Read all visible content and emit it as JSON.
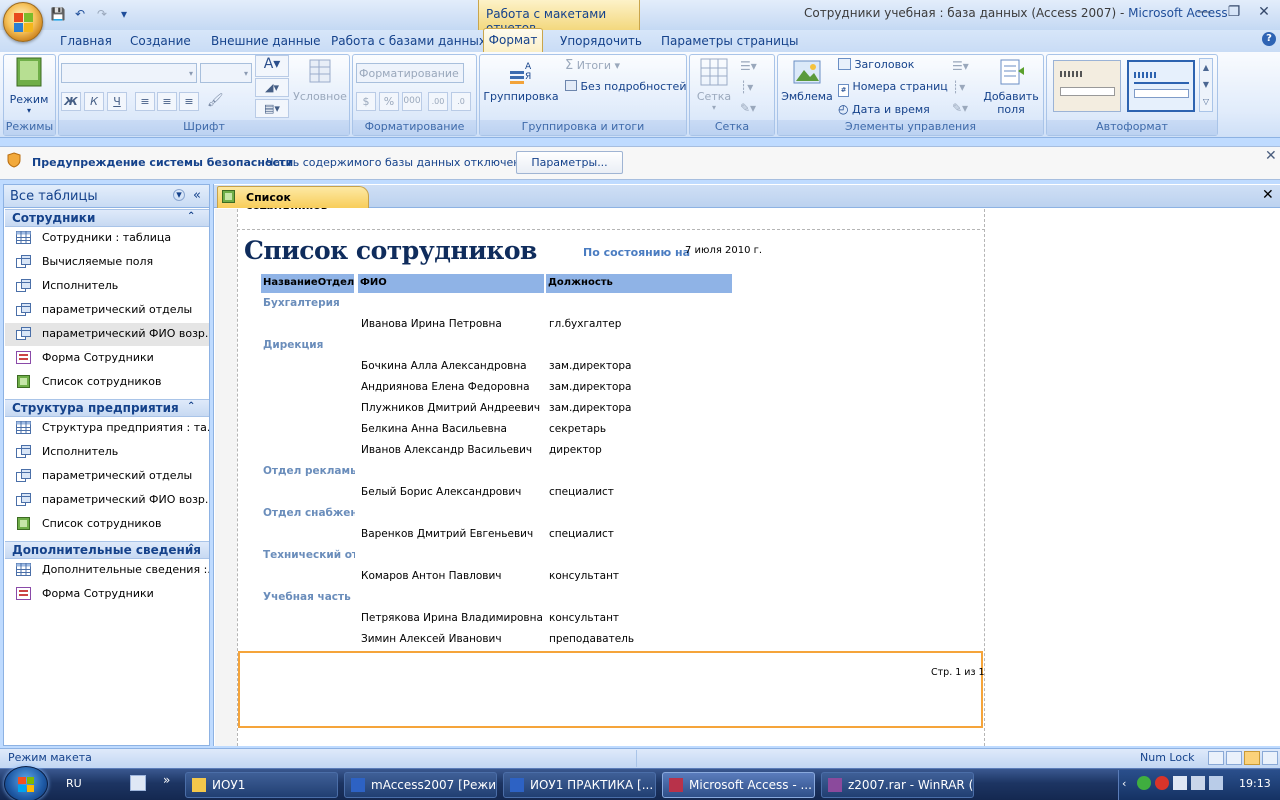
{
  "window": {
    "title": "Сотрудники учебная : база данных (Access 2007)",
    "title_sep": " - ",
    "app": "Microsoft Access",
    "context_tab_title": "Работа с макетами отчетов"
  },
  "tabs": [
    "Главная",
    "Создание",
    "Внешние данные",
    "Работа с базами данных",
    "Формат",
    "Упорядочить",
    "Параметры страницы"
  ],
  "ribbon": {
    "groups": {
      "views": "Режимы",
      "font": "Шрифт",
      "formatting": "Форматирование",
      "grouping": "Группировка и итоги",
      "gridlines": "Сетка",
      "controls": "Элементы управления",
      "autoformat": "Автоформат"
    },
    "buttons": {
      "view": "Режим",
      "conditional": "Условное",
      "format_combo": "Форматирование",
      "group": "Группировка",
      "totals": "Итоги",
      "hide_details": "Без подробностей",
      "gridlines": "Сетка",
      "logo": "Эмблема",
      "title": "Заголовок",
      "page_numbers": "Номера страниц",
      "date_time": "Дата и время",
      "add_fields_1": "Добавить",
      "add_fields_2": "поля"
    }
  },
  "security": {
    "title": "Предупреждение системы безопасности",
    "message": "Часть содержимого базы данных отключено",
    "button": "Параметры..."
  },
  "nav": {
    "header": "Все таблицы",
    "groups": [
      {
        "name": "Сотрудники",
        "items": [
          {
            "label": "Сотрудники : таблица",
            "icon": "table-icon"
          },
          {
            "label": "Вычисляемые поля",
            "icon": "query-icon"
          },
          {
            "label": "Исполнитель",
            "icon": "query-icon"
          },
          {
            "label": "параметрический отделы",
            "icon": "query-icon"
          },
          {
            "label": "параметрический ФИО возр...",
            "icon": "query-icon"
          },
          {
            "label": "Форма Сотрудники",
            "icon": "form-icon"
          },
          {
            "label": "Список сотрудников",
            "icon": "report-icon"
          }
        ]
      },
      {
        "name": "Структура предприятия",
        "items": [
          {
            "label": "Структура предприятия : та...",
            "icon": "table-icon"
          },
          {
            "label": "Исполнитель",
            "icon": "query-icon"
          },
          {
            "label": "параметрический отделы",
            "icon": "query-icon"
          },
          {
            "label": "параметрический ФИО возр...",
            "icon": "query-icon"
          },
          {
            "label": "Список сотрудников",
            "icon": "report-icon"
          }
        ]
      },
      {
        "name": "Дополнительные сведения",
        "items": [
          {
            "label": "Дополнительные сведения :...",
            "icon": "table-icon"
          },
          {
            "label": "Форма Сотрудники",
            "icon": "form-icon"
          }
        ]
      }
    ]
  },
  "document": {
    "tab_label": "Список сотрудников"
  },
  "report": {
    "title": "Список сотрудников",
    "date_label": "По состоянию на",
    "date": "7 июля 2010 г.",
    "columns": [
      "НазваниеОтдела",
      "ФИО",
      "Должность"
    ],
    "departments": [
      {
        "name": "Бухгалтерия",
        "rows": [
          [
            "Иванова Ирина Петровна",
            "гл.бухгалтер"
          ]
        ]
      },
      {
        "name": "Дирекция",
        "rows": [
          [
            "Бочкина Алла Александровна",
            "зам.директора"
          ],
          [
            "Андриянова Елена Федоровна",
            "зам.директора"
          ],
          [
            "Плужников Дмитрий Андреевич",
            "зам.директора"
          ],
          [
            "Белкина Анна Васильевна",
            "секретарь"
          ],
          [
            "Иванов Александр Васильевич",
            "директор"
          ]
        ]
      },
      {
        "name": "Отдел рекламы",
        "rows": [
          [
            "Белый Борис Александрович",
            "специалист"
          ]
        ]
      },
      {
        "name": "Отдел снабжения",
        "rows": [
          [
            "Варенков Дмитрий Евгеньевич",
            "специалист"
          ]
        ]
      },
      {
        "name": "Технический отд",
        "rows": [
          [
            "Комаров Антон Павлович",
            "консультант"
          ]
        ]
      },
      {
        "name": "Учебная часть",
        "rows": [
          [
            "Петрякова Ирина Владимировна",
            "консультант"
          ],
          [
            "Зимин Алексей Иванович",
            "преподаватель"
          ]
        ]
      }
    ],
    "page_number": "Стр. 1 из 1"
  },
  "status": {
    "mode": "Режим макета",
    "numlock": "Num Lock"
  },
  "taskbar": {
    "lang": "RU",
    "items": [
      {
        "label": "ИОУ1",
        "icon": "folder-icon"
      },
      {
        "label": "mAccess2007 [Режи...",
        "icon": "word-icon"
      },
      {
        "label": "ИОУ1 ПРАКТИКА [...",
        "icon": "word-icon"
      },
      {
        "label": "Microsoft Access - ...",
        "icon": "access-icon"
      },
      {
        "label": "z2007.rar - WinRAR (...",
        "icon": "winrar-icon"
      }
    ],
    "clock": "19:13"
  }
}
